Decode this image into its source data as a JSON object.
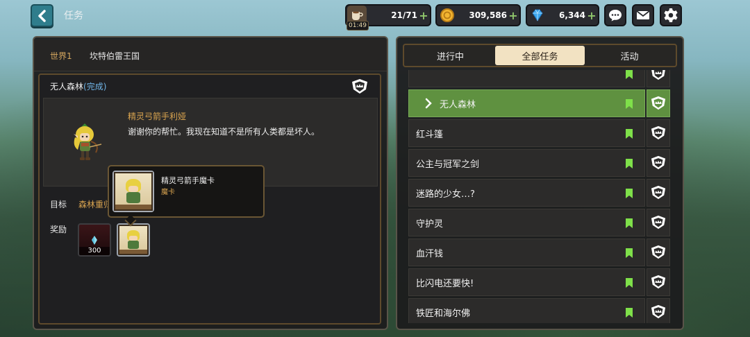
{
  "header": {
    "title": "任务",
    "stamina": {
      "value": "21/71",
      "timer": "01:49"
    },
    "gold": {
      "value": "309,586"
    },
    "gems": {
      "value": "6,344"
    },
    "icons": [
      "back-arrow-icon",
      "cup-icon",
      "coin-icon",
      "diamond-icon",
      "chat-icon",
      "mail-icon",
      "gear-icon"
    ],
    "colors": {
      "plus": "#8fc66b",
      "back": "#2f7d8c"
    }
  },
  "left": {
    "world": "世界1",
    "region": "坎特伯雷王国",
    "quest_name": "无人森林",
    "quest_status": "(完成)",
    "npc_name": "精灵弓箭手利娅",
    "npc_text": "谢谢你的帮忙。我现在知道不是所有人类都是坏人。",
    "goal_label": "目标",
    "goal_value": "森林重归",
    "reward_label": "奖励",
    "reward_gem_qty": "300",
    "tooltip_title": "精灵弓箭手魔卡",
    "tooltip_sub": "魔卡"
  },
  "tabs": [
    "进行中",
    "全部任务",
    "活动"
  ],
  "active_tab": "全部任务",
  "quests": [
    {
      "label": "",
      "active": false,
      "partial": true
    },
    {
      "label": "无人森林",
      "active": true
    },
    {
      "label": "红斗篷",
      "active": false
    },
    {
      "label": "公主与冠军之剑",
      "active": false
    },
    {
      "label": "迷路的少女…?",
      "active": false
    },
    {
      "label": "守护灵",
      "active": false
    },
    {
      "label": "血汗钱",
      "active": false
    },
    {
      "label": "比闪电还要快!",
      "active": false
    },
    {
      "label": "铁匠和海尔佛",
      "active": false
    }
  ],
  "colors": {
    "accent_gold": "#d8a34f",
    "active_row": "#5f9140",
    "bookmark": "#7fe04a",
    "status_blue": "#6fb4e6"
  }
}
